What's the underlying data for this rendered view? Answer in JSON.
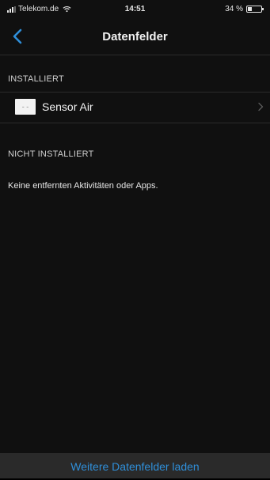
{
  "status_bar": {
    "carrier": "Telekom.de",
    "time": "14:51",
    "battery": "34 %",
    "battery_level": 0.34
  },
  "nav": {
    "title": "Datenfelder",
    "back_icon": "chevron-left-icon"
  },
  "sections": {
    "installed": {
      "header": "INSTALLIERT",
      "items": [
        {
          "label": "Sensor Air"
        }
      ]
    },
    "not_installed": {
      "header": "NICHT INSTALLIERT",
      "empty_message": "Keine entfernten Aktivitäten oder Apps."
    }
  },
  "footer": {
    "button_label": "Weitere Datenfelder laden"
  },
  "colors": {
    "accent": "#2f8fd9",
    "background": "#101010",
    "footer_background": "#2a2a2a",
    "divider": "#2b2b2b"
  }
}
